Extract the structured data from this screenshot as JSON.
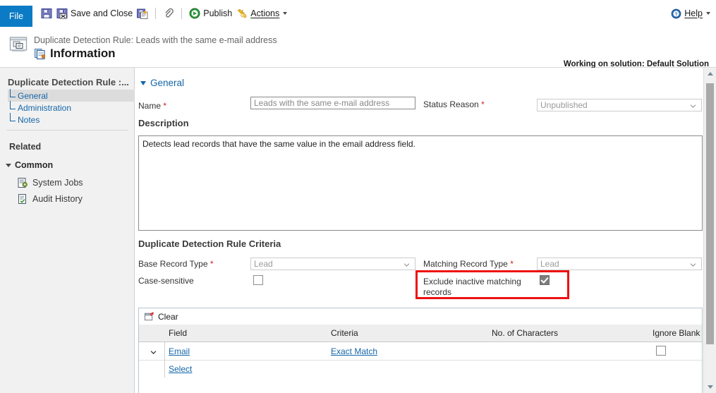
{
  "ribbon": {
    "file_tab": "File",
    "buttons": [
      {
        "label": "",
        "icon": "save-icon",
        "name": "save-button"
      },
      {
        "label": "Save and Close",
        "icon": "save-and-close-icon",
        "name": "save-and-close-button"
      },
      {
        "label": "",
        "icon": "save-as-new-icon",
        "name": "save-as-new-button"
      },
      {
        "label": "",
        "icon": "attach-icon",
        "name": "attach-button"
      },
      {
        "label": "Publish",
        "icon": "publish-icon",
        "name": "publish-button"
      },
      {
        "label": "Actions",
        "icon": "actions-icon",
        "name": "actions-button"
      }
    ],
    "help_label": "Help",
    "help_icon": "help-icon"
  },
  "header": {
    "record_type": "Duplicate Detection Rule: Leads with the same e-mail address",
    "form_title": "Information",
    "solution_note": "Working on solution: Default Solution",
    "record_icon": "duplicate-detection-rule-icon",
    "form_icon": "information-form-icon"
  },
  "sidebar": {
    "title": "Duplicate Detection Rule :...",
    "nav_items": [
      {
        "label": "General",
        "selected": true
      },
      {
        "label": "Administration",
        "selected": false
      },
      {
        "label": "Notes",
        "selected": false
      }
    ],
    "related_label": "Related",
    "group_label": "Common",
    "related_items": [
      {
        "label": "System Jobs",
        "icon": "system-jobs-icon"
      },
      {
        "label": "Audit History",
        "icon": "audit-history-icon"
      }
    ]
  },
  "form": {
    "general_section": "General",
    "name_label": "Name",
    "name_value": "Leads with the same e-mail address",
    "status_reason_label": "Status Reason",
    "status_reason_value": "Unpublished",
    "description_label": "Description",
    "description_value": "Detects lead records that have the same value in the email address field.",
    "criteria_section": "Duplicate Detection Rule Criteria",
    "base_record_type_label": "Base Record Type",
    "base_record_type_value": "Lead",
    "matching_record_type_label": "Matching Record Type",
    "matching_record_type_value": "Lead",
    "case_sensitive_label": "Case-sensitive",
    "case_sensitive_checked": false,
    "exclude_inactive_label": "Exclude inactive matching records",
    "exclude_inactive_checked": true,
    "required_marker": "*"
  },
  "grid": {
    "clear_label": "Clear",
    "clear_icon": "clear-icon",
    "columns": [
      "Field",
      "Criteria",
      "No. of Characters",
      "Ignore Blank"
    ],
    "rows": [
      {
        "field": "Email",
        "criteria": "Exact Match",
        "no_of_characters": "",
        "ignore_blank_checked": false
      },
      {
        "field": "Select",
        "criteria": "",
        "no_of_characters": "",
        "ignore_blank_checked": null
      }
    ]
  },
  "colors": {
    "accent": "#0a7bc4",
    "link": "#1566a8",
    "annotation": "#ee1111",
    "required": "#cc2222"
  }
}
